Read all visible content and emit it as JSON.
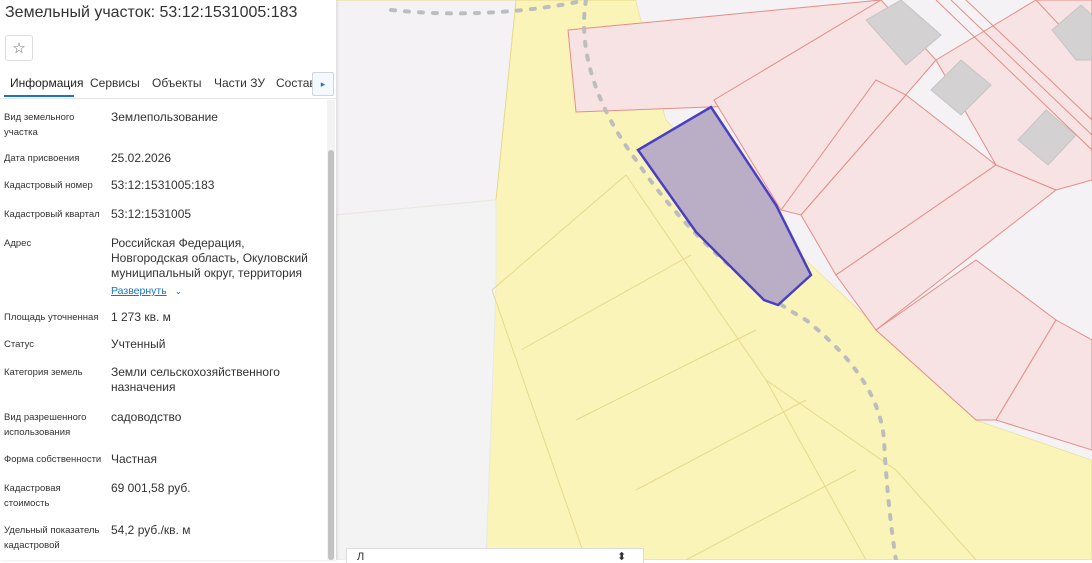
{
  "panel": {
    "title": "Земельный участок: 53:12:1531005:183",
    "favorite_icon": "☆",
    "tabs": [
      {
        "label": "Информация"
      },
      {
        "label": "Сервисы"
      },
      {
        "label": "Объекты"
      },
      {
        "label": "Части ЗУ"
      },
      {
        "label": "Состав"
      }
    ],
    "tab_next_icon": "▸",
    "rows": [
      {
        "label": "Вид земельного участка",
        "value": "Землепользование"
      },
      {
        "label": "Дата присвоения",
        "value": "25.02.2026"
      },
      {
        "label": "Кадастровый номер",
        "value": "53:12:1531005:183"
      },
      {
        "label": "Кадастровый квартал",
        "value": "53:12:1531005"
      },
      {
        "label": "Адрес",
        "value": "Российская Федерация, Новгородская область, Окуловский муниципальный округ, территория",
        "expand": "Развернуть",
        "expand_icon": "⌄"
      },
      {
        "label": "Площадь уточненная",
        "value": "1 273 кв. м"
      },
      {
        "label": "Статус",
        "value": "Учтенный"
      },
      {
        "label": "Категория земель",
        "value": "Земли сельскохозяйственного назначения"
      },
      {
        "label": "Вид разрешенного использования",
        "value": "садоводство"
      },
      {
        "label": "Форма собственности",
        "value": "Частная"
      },
      {
        "label": "Кадастровая стоимость",
        "value": "69 001,58 руб."
      },
      {
        "label": "Удельный показатель кадастровой",
        "value": "54,2 руб./кв. м"
      }
    ]
  },
  "map": {
    "colors": {
      "background": "#f4f2f5",
      "agricultural": "#fbf4b9",
      "agricultural_stroke": "#e5d98a",
      "residential": "#f7e3e4",
      "residential_stroke": "#e58d86",
      "building": "#d3d1d2",
      "selected_fill": "#b9aec6",
      "selected_stroke": "#4a3fc2",
      "road_dots": "#bdbdbd"
    },
    "bottom_panel": {
      "text": "Л",
      "icon": "⬍"
    }
  }
}
